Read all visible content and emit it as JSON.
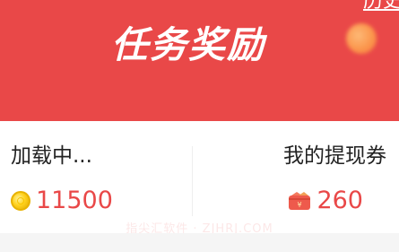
{
  "header": {
    "title": "任务奖励",
    "top_link": "历史"
  },
  "stats": {
    "left": {
      "label": "加载中...",
      "value": "11500",
      "icon": "gold-coin-icon"
    },
    "right": {
      "label": "我的提现券",
      "value": "260",
      "icon": "coupon-wallet-icon"
    }
  },
  "watermark": "指尖汇软件 · ZJHRJ.COM",
  "colors": {
    "header_red": "#e94848",
    "value_red": "#e94848",
    "coin_gold": "#ffd21e",
    "orb_orange": "#fd9a4c"
  }
}
